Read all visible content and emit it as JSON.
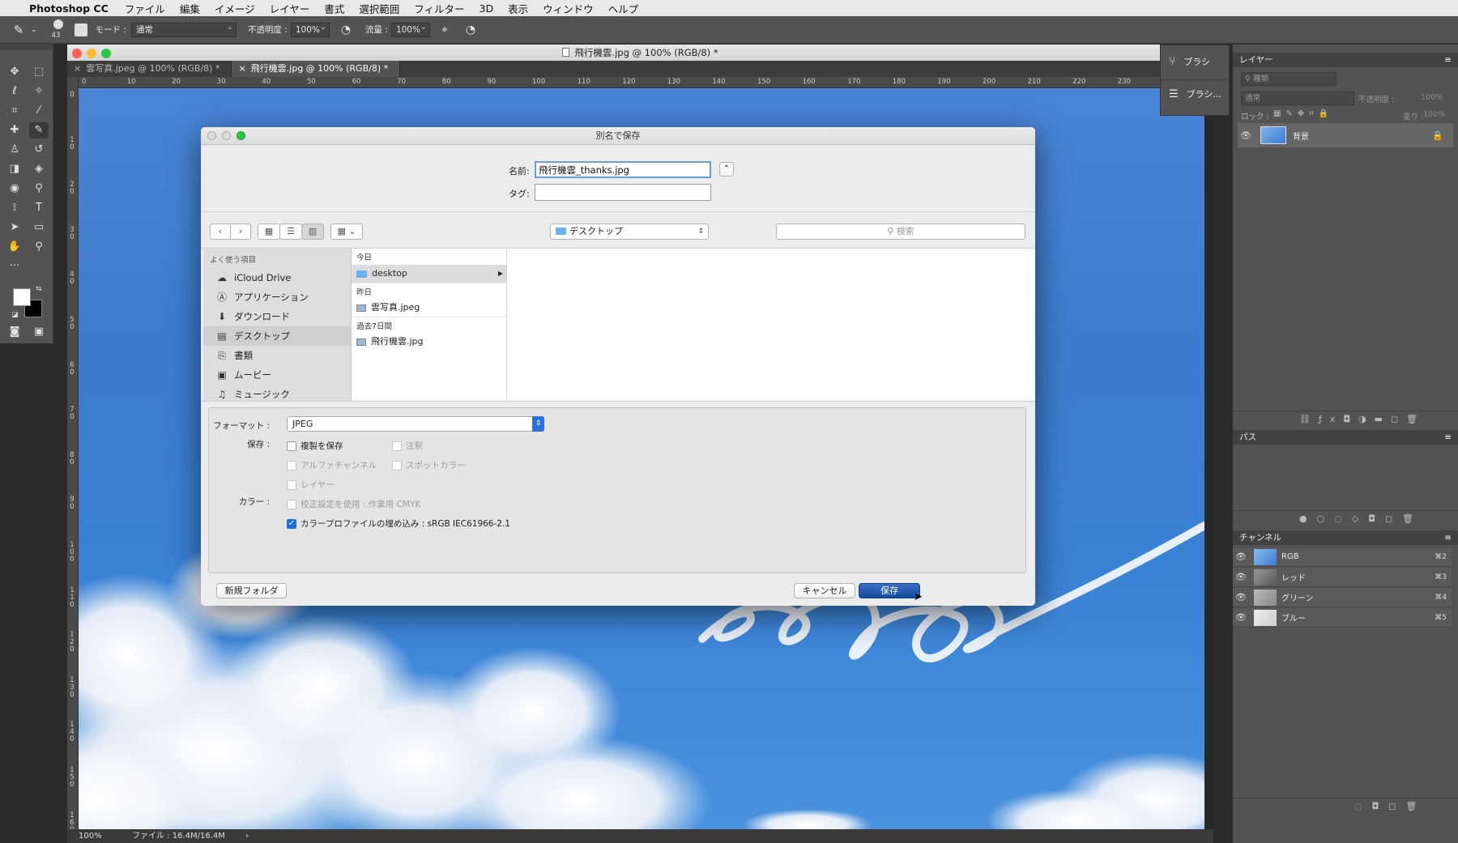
{
  "menubar": {
    "app_name": "Photoshop CC",
    "items": [
      "ファイル",
      "編集",
      "イメージ",
      "レイヤー",
      "書式",
      "選択範囲",
      "フィルター",
      "3D",
      "表示",
      "ウィンドウ",
      "ヘルプ"
    ]
  },
  "options_bar": {
    "brush_size": "43",
    "mode_label": "モード :",
    "mode_value": "通常",
    "opacity_label": "不透明度 :",
    "opacity_value": "100%",
    "flow_label": "流量 :",
    "flow_value": "100%"
  },
  "document": {
    "window_title": "飛行機雲.jpg @ 100% (RGB/8) *",
    "tabs": [
      {
        "label": "雲写真.jpeg @ 100% (RGB/8) *",
        "active": false
      },
      {
        "label": "飛行機雲.jpg @ 100% (RGB/8) *",
        "active": true
      }
    ],
    "ruler_top": [
      "0",
      "10",
      "20",
      "30",
      "40",
      "50",
      "60",
      "70",
      "80",
      "90",
      "100",
      "110",
      "120",
      "130",
      "140",
      "150",
      "160",
      "170",
      "180",
      "190",
      "200",
      "210",
      "220",
      "230"
    ],
    "ruler_left": [
      "0",
      "1\n0",
      "2\n0",
      "3\n0",
      "4\n0",
      "5\n0",
      "6\n0",
      "7\n0",
      "8\n0",
      "9\n0",
      "1\n0\n0",
      "1\n1\n0",
      "1\n2\n0",
      "1\n3\n0",
      "1\n4\n0",
      "1\n5\n0",
      "1\n6\n0"
    ],
    "status_zoom": "100%",
    "status_file": "ファイル : 16.4M/16.4M"
  },
  "brush_panel": {
    "items": [
      "ブラシ",
      "ブラシ..."
    ]
  },
  "layers_panel": {
    "title": "レイヤー",
    "search_placeholder": "種類",
    "blend_mode": "通常",
    "opacity_label": "不透明度 :",
    "opacity_value": "100%",
    "lock_label": "ロック :",
    "fill_label": "塗り :",
    "fill_value": "100%",
    "layer_name": "背景"
  },
  "paths_panel": {
    "title": "パス"
  },
  "channels_panel": {
    "title": "チャンネル",
    "channels": [
      {
        "name": "RGB",
        "shortcut": "⌘2"
      },
      {
        "name": "レッド",
        "shortcut": "⌘3"
      },
      {
        "name": "グリーン",
        "shortcut": "⌘4"
      },
      {
        "name": "ブルー",
        "shortcut": "⌘5"
      }
    ]
  },
  "dialog": {
    "title": "別名で保存",
    "name_label": "名前:",
    "name_value": "飛行機雲_thanks.jpg",
    "tag_label": "タグ:",
    "location": "デスクトップ",
    "search_placeholder": "検索",
    "sidebar_header": "よく使う項目",
    "sidebar_items": [
      {
        "label": "iCloud Drive",
        "icon": "cloud-icon"
      },
      {
        "label": "アプリケーション",
        "icon": "applications-icon"
      },
      {
        "label": "ダウンロード",
        "icon": "download-icon"
      },
      {
        "label": "デスクトップ",
        "icon": "desktop-icon"
      },
      {
        "label": "書類",
        "icon": "documents-icon"
      },
      {
        "label": "ムービー",
        "icon": "movies-icon"
      },
      {
        "label": "ミュージック",
        "icon": "music-icon"
      }
    ],
    "groups": [
      {
        "label": "今日",
        "files": [
          "desktop"
        ]
      },
      {
        "label": "昨日",
        "files": [
          "雲写真.jpeg"
        ]
      },
      {
        "label": "過去7日間",
        "files": [
          "飛行機雲.jpg"
        ]
      }
    ],
    "format_label": "フォーマット :",
    "format_value": "JPEG",
    "save_label": "保存 :",
    "color_label": "カラー :",
    "options": {
      "save_copy": "複製を保存",
      "annotations": "注釈",
      "alpha_channels": "アルファチャンネル",
      "spot_colors": "スポットカラー",
      "layers": "レイヤー",
      "proof_setup": "校正設定を使用 : 作業用 CMYK",
      "embed_profile": "カラープロファイルの埋め込み : sRGB IEC61966-2.1"
    },
    "new_folder_button": "新規フォルダ",
    "cancel_button": "キャンセル",
    "save_button": "保存"
  }
}
